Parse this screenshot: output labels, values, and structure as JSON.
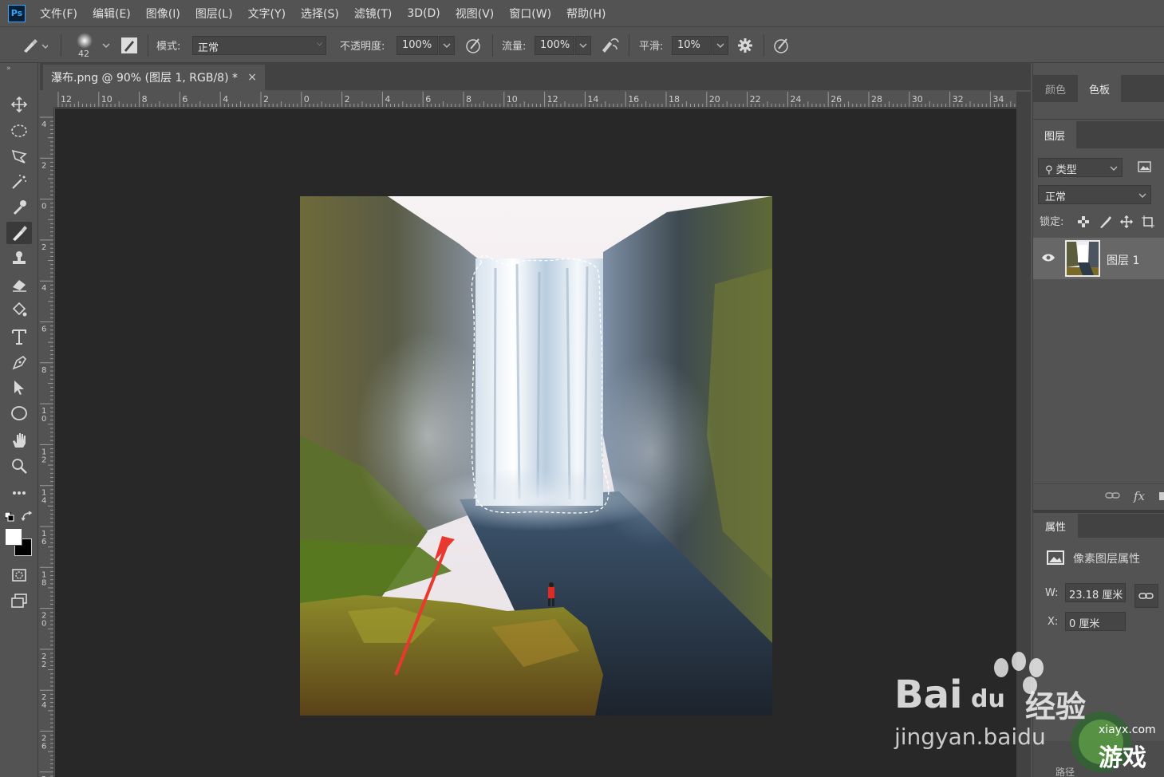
{
  "app": {
    "logo": "Ps"
  },
  "menu": [
    "文件(F)",
    "编辑(E)",
    "图像(I)",
    "图层(L)",
    "文字(Y)",
    "选择(S)",
    "滤镜(T)",
    "3D(D)",
    "视图(V)",
    "窗口(W)",
    "帮助(H)"
  ],
  "options": {
    "brush_size": "42",
    "mode_label": "模式:",
    "mode_value": "正常",
    "opacity_label": "不透明度:",
    "opacity_value": "100%",
    "flow_label": "流量:",
    "flow_value": "100%",
    "smooth_label": "平滑:",
    "smooth_value": "10%"
  },
  "document": {
    "tab_title": "瀑布.png @ 90% (图层 1, RGB/8) *",
    "close_glyph": "×"
  },
  "ruler": {
    "h_labels": [
      "12",
      "10",
      "8",
      "6",
      "4",
      "2",
      "0",
      "2",
      "4",
      "6",
      "8",
      "10",
      "12",
      "14",
      "16",
      "18",
      "20",
      "22",
      "24",
      "26",
      "28",
      "30",
      "32",
      "34"
    ],
    "v_labels": [
      "4",
      "2",
      "0",
      "2",
      "4",
      "6",
      "8",
      "10",
      "12",
      "14",
      "16",
      "18",
      "20",
      "22",
      "24",
      "26",
      "2"
    ]
  },
  "panels": {
    "color_tab": "颜色",
    "swatches_tab": "色板",
    "layers_tab": "图层",
    "filter_kind": "类型",
    "blend_mode": "正常",
    "lock_label": "锁定:",
    "layer_name": "图层 1",
    "properties_tab": "属性",
    "properties_type": "像素图层属性",
    "w_label": "W:",
    "w_value": "23.18 厘米",
    "x_label": "X:",
    "x_value": "0 厘米",
    "fx_label": "fx"
  },
  "watermark": {
    "line1": "Bai",
    "line1b": "du",
    "line1c": "经验",
    "line2": "jingyan.baidu",
    "site": "xiayx.com",
    "game": "游戏",
    "path": "路径"
  },
  "colors": {
    "accent": "#31a8ff",
    "canvas_bg": "#282828",
    "panel_bg": "#535353",
    "selection": "#ffffff",
    "arrow": "#e8382f"
  }
}
